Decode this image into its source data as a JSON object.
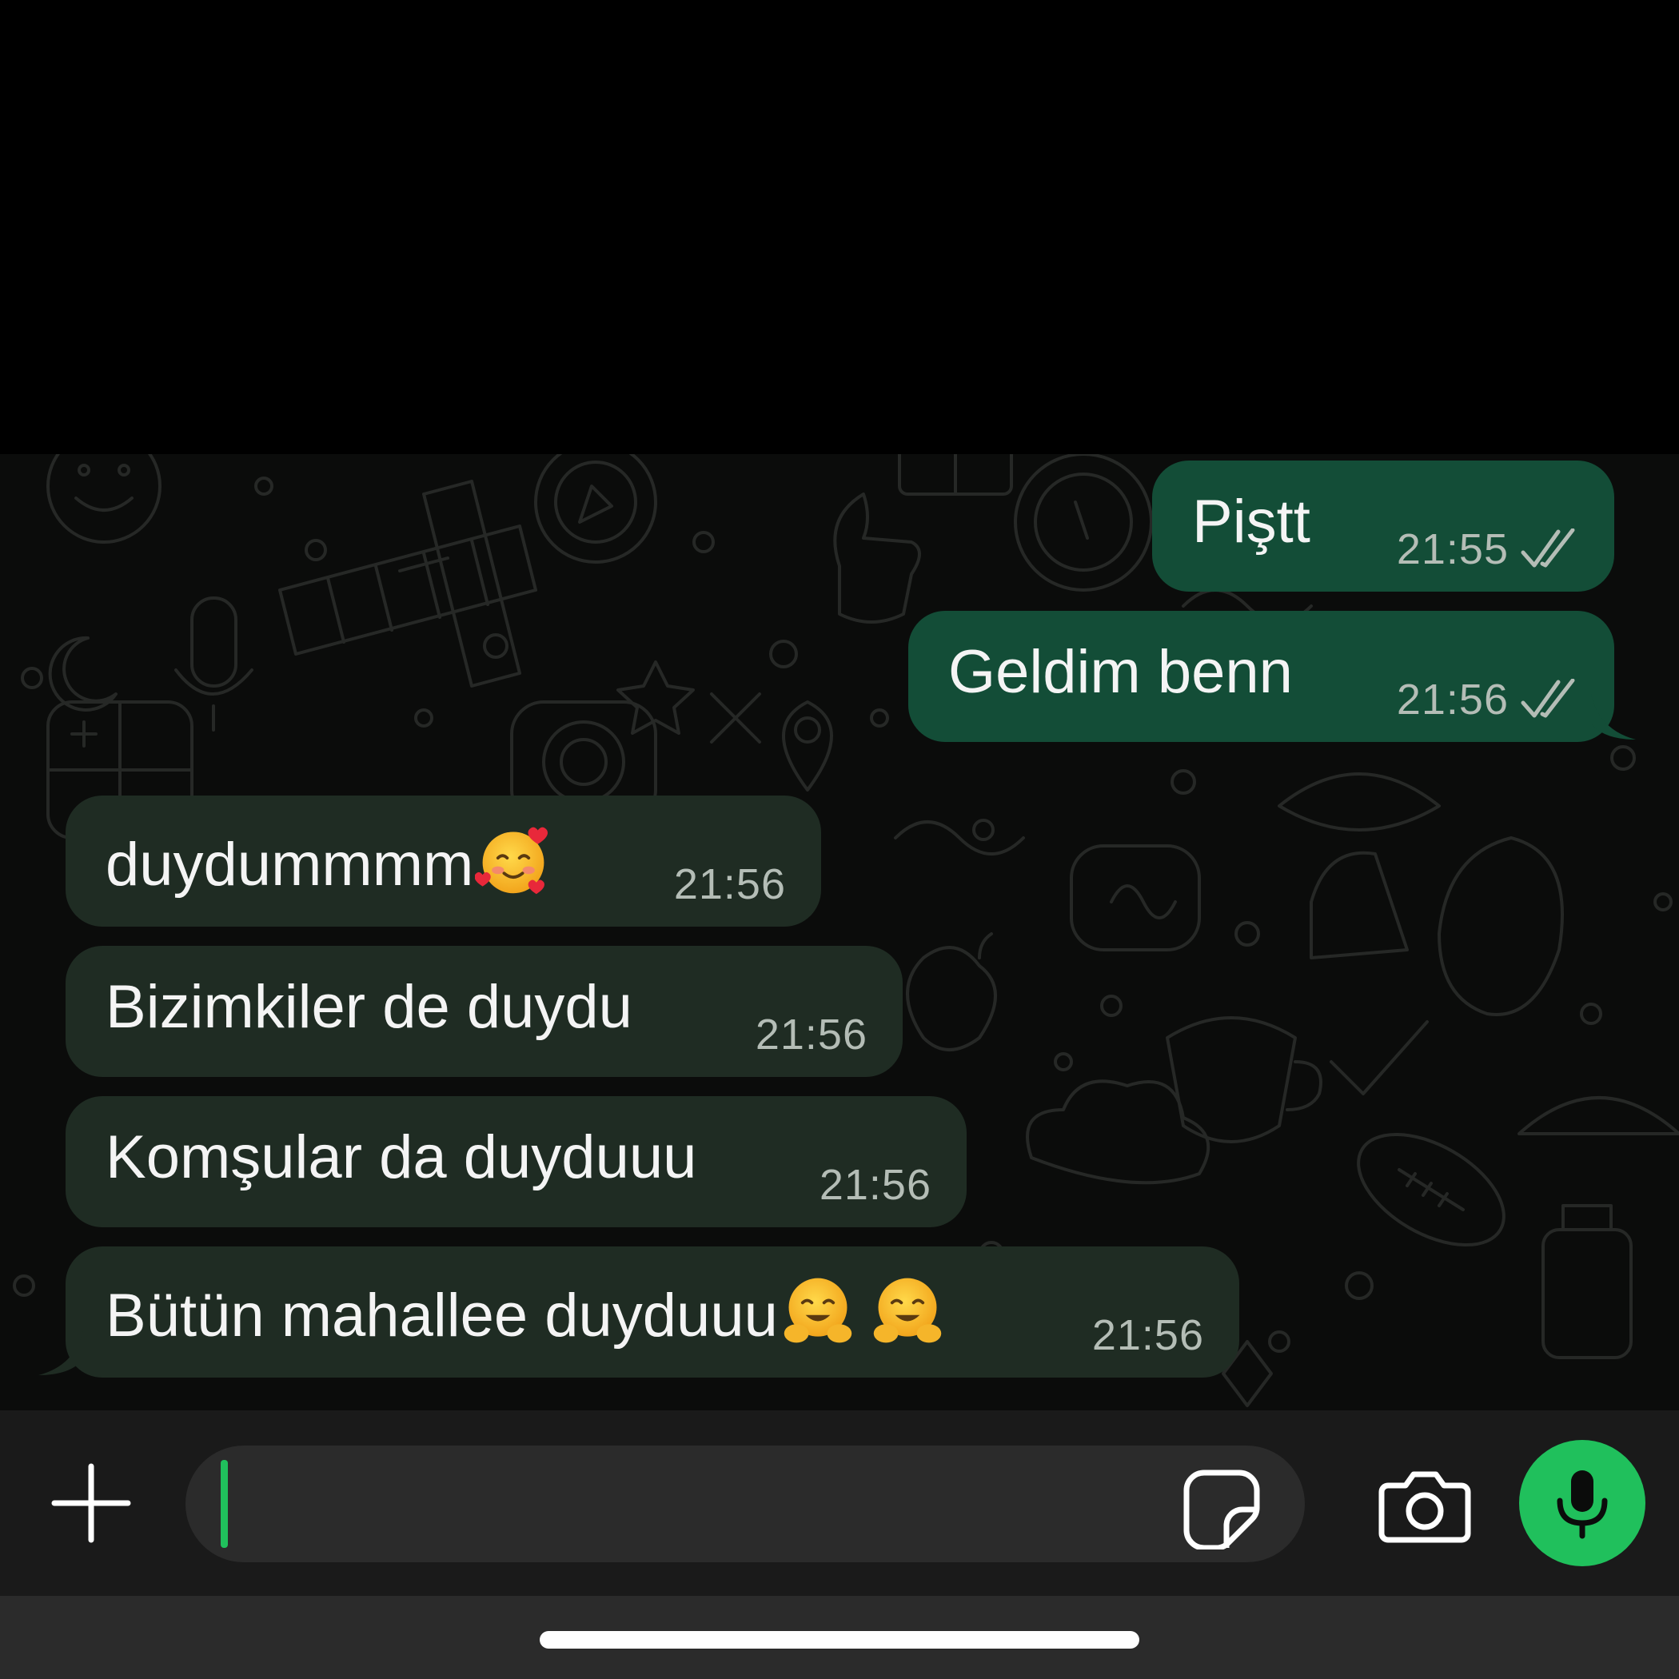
{
  "messages": [
    {
      "direction": "outgoing",
      "text": "Piştt",
      "time": "21:55",
      "status": "read"
    },
    {
      "direction": "outgoing",
      "text": "Geldim benn",
      "time": "21:56",
      "status": "read"
    },
    {
      "direction": "incoming",
      "text": "duydummmm",
      "emojis": [
        "smiling-face-with-hearts"
      ],
      "time": "21:56"
    },
    {
      "direction": "incoming",
      "text": "Bizimkiler de duydu",
      "time": "21:56"
    },
    {
      "direction": "incoming",
      "text": "Komşular da duyduuu",
      "time": "21:56"
    },
    {
      "direction": "incoming",
      "text": "Bütün mahallee duyduuu",
      "emojis": [
        "hugging-face",
        "hugging-face"
      ],
      "time": "21:56"
    }
  ],
  "composer": {
    "value": "",
    "icons": [
      "plus-icon",
      "sticker-icon",
      "camera-icon",
      "microphone-icon"
    ]
  },
  "colors": {
    "outgoing_bubble": "#134d37",
    "incoming_bubble": "#1f2c23",
    "accent": "#20c05c",
    "chat_background": "#0b0c0b"
  }
}
